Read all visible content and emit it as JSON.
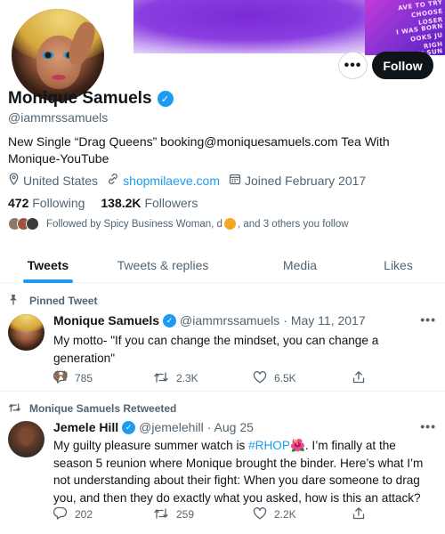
{
  "banner": {
    "poster_lines": [
      "AVE TO TRY",
      "CHOOSE",
      "LOSER",
      "I WAS BORN",
      "OOKS JU",
      "RIGH",
      "Y SUN"
    ]
  },
  "profile": {
    "name": "Monique Samuels",
    "handle": "@iammrssamuels",
    "bio": "New Single “Drag Queens” booking@moniquesamuels.com Tea With Monique-YouTube",
    "location": "United States",
    "website": "shopmilaeve.com",
    "joined": "Joined February 2017",
    "following_count": "472",
    "following_label": "Following",
    "followers_count": "138.2K",
    "followers_label": "Followers",
    "followed_by_prefix": "Followed by Spicy Business Woman, d",
    "followed_by_suffix": ", and 3 others you follow"
  },
  "buttons": {
    "more": "•••",
    "follow": "Follow"
  },
  "tabs": [
    {
      "label": "Tweets",
      "active": true
    },
    {
      "label": "Tweets & replies",
      "active": false
    },
    {
      "label": "Media",
      "active": false
    },
    {
      "label": "Likes",
      "active": false
    }
  ],
  "tweets": [
    {
      "social_context": "Pinned Tweet",
      "social_icon": "pin-icon",
      "author": "Monique Samuels",
      "handle": "@iammrssamuels",
      "date": "· May 11, 2017",
      "text": "My motto- \"If you can change the mindset, you can change a generation\"",
      "emoji": "🙌🏾",
      "replies": "785",
      "retweets": "2.3K",
      "likes": "6.5K"
    },
    {
      "social_context": "Monique Samuels Retweeted",
      "social_icon": "retweet-icon",
      "author": "Jemele Hill",
      "handle": "@jemelehill",
      "date": "· Aug 25",
      "text_before": "My guilty pleasure summer watch is ",
      "hashtag": "#RHOP",
      "emoji": "🌺",
      "text_after": ". I’m finally at the season 5 reunion where Monique brought the binder. Here’s what I’m not understanding about their fight: When you dare someone to drag you, and then they do exactly what you asked, how is this an attack?",
      "replies": "202",
      "retweets": "259",
      "likes": "2.2K"
    }
  ],
  "colors": {
    "accent": "#1d9bf0",
    "text_primary": "#0f1419",
    "text_secondary": "#536471",
    "follow_button": "#0f1419",
    "banner_purple": "#7b2bd6"
  }
}
